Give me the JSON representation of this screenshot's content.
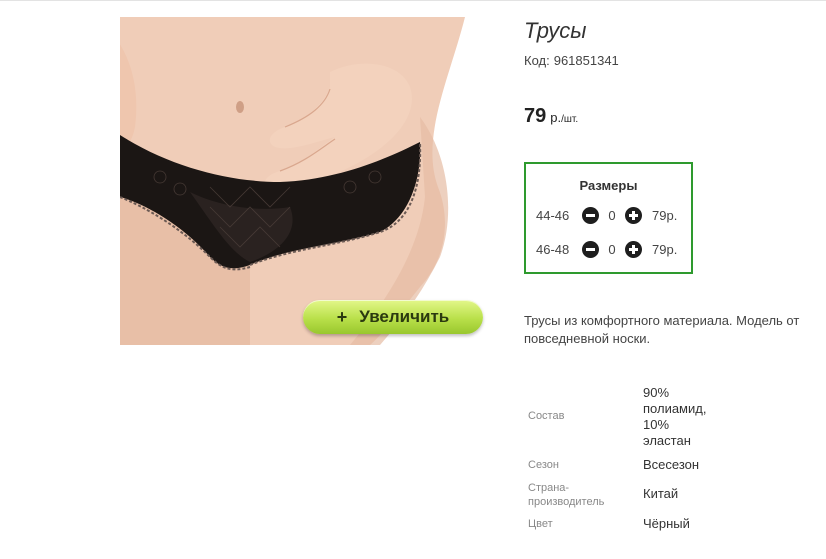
{
  "product": {
    "title": "Трусы",
    "code_label": "Код:",
    "code_value": "961851341",
    "price": "79",
    "price_unit": "р.",
    "price_unit_suffix": "/шт."
  },
  "zoom": {
    "plus": "+",
    "label": "Увеличить"
  },
  "sizes": {
    "title": "Размеры",
    "rows": [
      {
        "size": "44-46",
        "qty": "0",
        "price": "79р."
      },
      {
        "size": "46-48",
        "qty": "0",
        "price": "79р."
      }
    ]
  },
  "description": "Трусы из комфортного материала. Модель от повседневной носки.",
  "specs": [
    {
      "label": "Состав",
      "value_lines": [
        "90%",
        "полиамид,",
        "10%",
        "эластан"
      ]
    },
    {
      "label": "Сезон",
      "value": "Всесезон"
    },
    {
      "label_lines": [
        "Страна-",
        "производитель"
      ],
      "value": "Китай"
    },
    {
      "label": "Цвет",
      "value": "Чёрный"
    }
  ],
  "colors": {
    "box_border": "#2e9a2e",
    "zoom_button": "#b9e04a"
  },
  "icons": {
    "minus": "minus-circle-icon",
    "plus": "plus-circle-icon"
  }
}
